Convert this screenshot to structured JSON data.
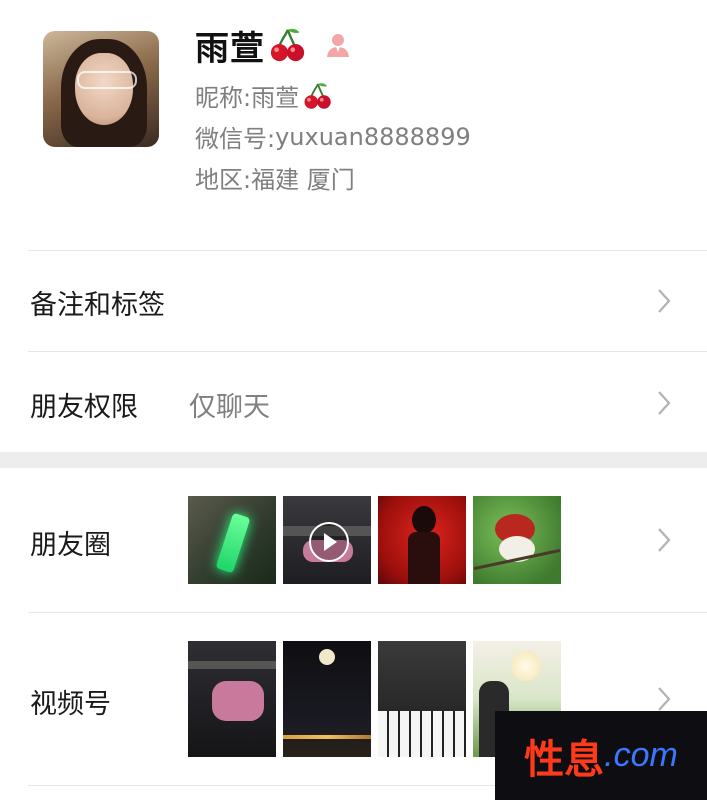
{
  "profile": {
    "name": "雨萱",
    "name_emoji_icon": "cherry-icon",
    "gender_icon": "female-user-icon",
    "nickname_label": "昵称:",
    "nickname_value": "雨萱",
    "wechat_id_label": "微信号:",
    "wechat_id_value": "yuxuan8888899",
    "region_label": "地区:",
    "region_value": "福建 厦门"
  },
  "rows": {
    "remarks_tags": {
      "label": "备注和标签"
    },
    "permissions": {
      "label": "朋友权限",
      "value": "仅聊天"
    },
    "moments": {
      "label": "朋友圈"
    },
    "channels": {
      "label": "视频号"
    }
  },
  "watermark": {
    "text_cn": "性息",
    "text_domain": ".com"
  },
  "colors": {
    "secondary_text": "#7f7f7f",
    "divider": "#e6e6e6",
    "section_gap": "#ededed",
    "watermark_red": "#ff3a1a",
    "watermark_blue": "#3c78ff"
  }
}
